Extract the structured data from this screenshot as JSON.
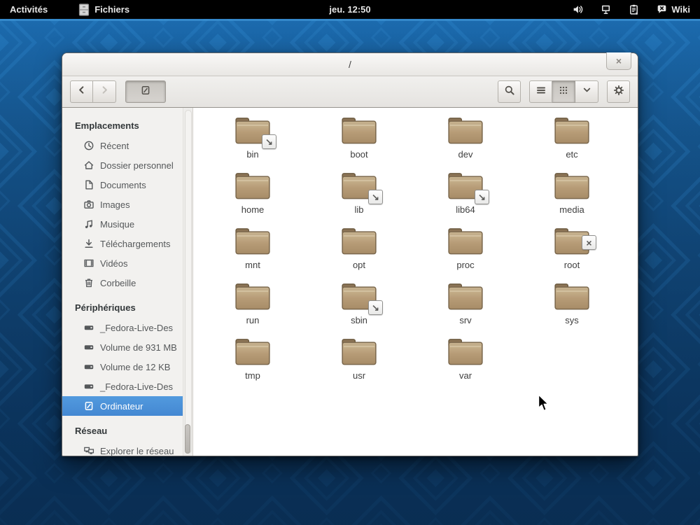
{
  "topbar": {
    "activities": "Activités",
    "app_name": "Fichiers",
    "clock": "jeu. 12:50",
    "status_label": "Wiki",
    "status_icons": [
      "volume-icon",
      "display-icon",
      "clipboard-icon",
      "chat-bubble-icon"
    ]
  },
  "window": {
    "title": "/",
    "close_glyph": "×"
  },
  "toolbar": {
    "icons": [
      "chevron-left-icon",
      "chevron-right-icon",
      "computer-icon",
      "search-icon",
      "list-view-icon",
      "grid-view-icon",
      "chevron-down-icon",
      "gear-icon"
    ]
  },
  "sidebar": {
    "sections": [
      {
        "title": "Emplacements",
        "items": [
          {
            "label": "Récent",
            "icon": "clock"
          },
          {
            "label": "Dossier personnel",
            "icon": "home"
          },
          {
            "label": "Documents",
            "icon": "document"
          },
          {
            "label": "Images",
            "icon": "camera"
          },
          {
            "label": "Musique",
            "icon": "music"
          },
          {
            "label": "Téléchargements",
            "icon": "download"
          },
          {
            "label": "Vidéos",
            "icon": "video"
          },
          {
            "label": "Corbeille",
            "icon": "trash"
          }
        ]
      },
      {
        "title": "Périphériques",
        "items": [
          {
            "label": "_Fedora-Live-Des",
            "icon": "drive"
          },
          {
            "label": "Volume de 931 MB",
            "icon": "drive"
          },
          {
            "label": "Volume de 12 KB",
            "icon": "drive"
          },
          {
            "label": "_Fedora-Live-Des",
            "icon": "drive"
          },
          {
            "label": "Ordinateur",
            "icon": "computer",
            "selected": true
          }
        ]
      },
      {
        "title": "Réseau",
        "items": [
          {
            "label": "Explorer le réseau",
            "icon": "network"
          }
        ]
      }
    ]
  },
  "main": {
    "emblem_glyphs": {
      "symlink": "↘",
      "no_access": "×"
    },
    "folders": [
      {
        "name": "bin",
        "emblem": "symlink"
      },
      {
        "name": "boot",
        "emblem": null
      },
      {
        "name": "dev",
        "emblem": null
      },
      {
        "name": "etc",
        "emblem": null
      },
      {
        "name": "home",
        "emblem": null
      },
      {
        "name": "lib",
        "emblem": "symlink"
      },
      {
        "name": "lib64",
        "emblem": "symlink"
      },
      {
        "name": "media",
        "emblem": null
      },
      {
        "name": "mnt",
        "emblem": null
      },
      {
        "name": "opt",
        "emblem": null
      },
      {
        "name": "proc",
        "emblem": null
      },
      {
        "name": "root",
        "emblem": "no_access"
      },
      {
        "name": "run",
        "emblem": null
      },
      {
        "name": "sbin",
        "emblem": "symlink"
      },
      {
        "name": "srv",
        "emblem": null
      },
      {
        "name": "sys",
        "emblem": null
      },
      {
        "name": "tmp",
        "emblem": null
      },
      {
        "name": "usr",
        "emblem": null
      },
      {
        "name": "var",
        "emblem": null
      }
    ]
  },
  "colors": {
    "selection_blue": "#4a90d9",
    "topbar_bg": "#000000",
    "folder_body": "#b79c77",
    "folder_tab": "#8c7456",
    "wallpaper_base": "#14548e",
    "wallpaper_pattern": "#2e86cc"
  }
}
